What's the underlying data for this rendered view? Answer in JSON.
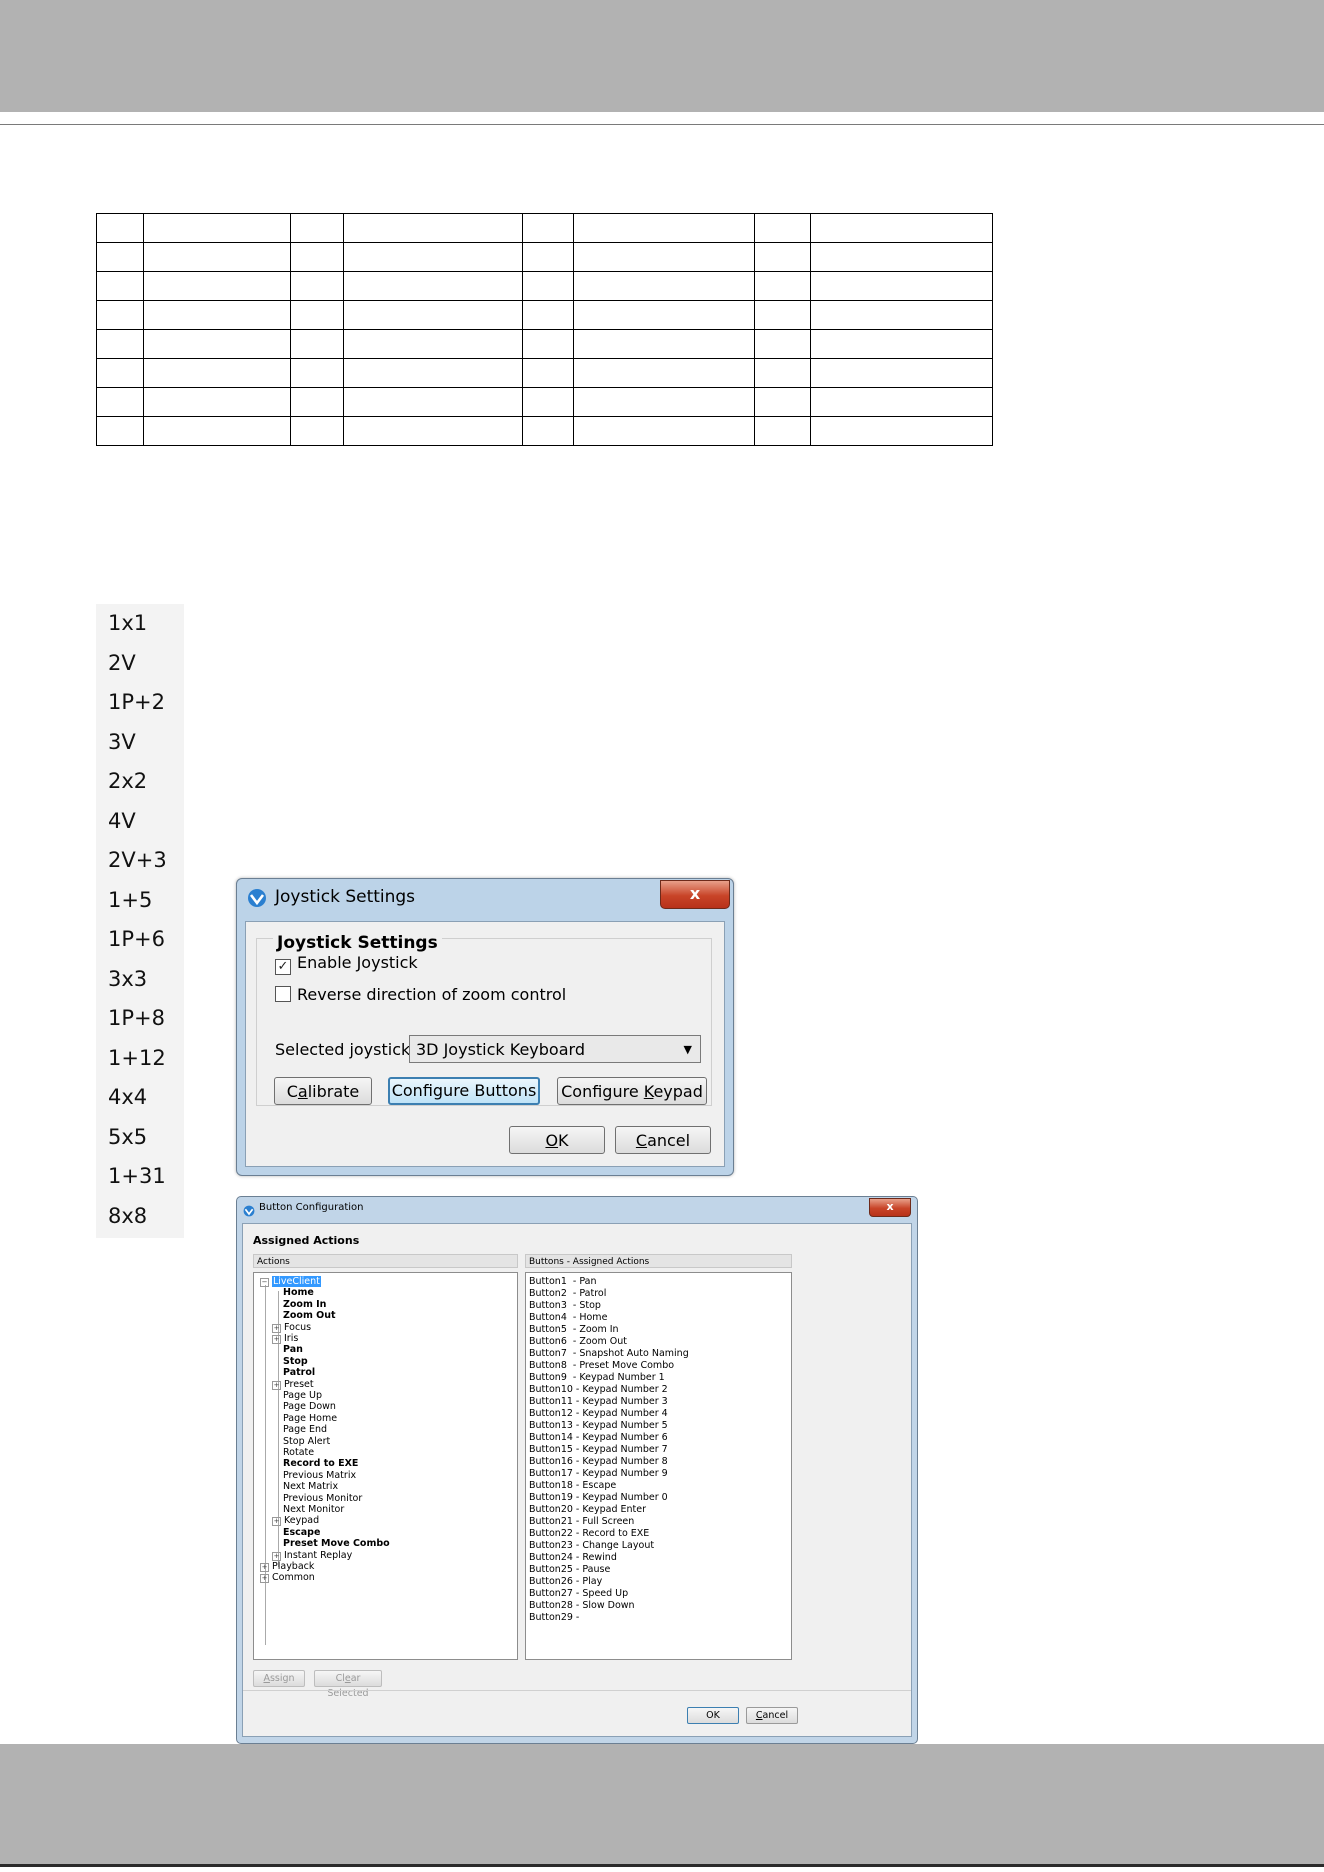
{
  "layouts": [
    "1x1",
    "2V",
    "1P+2",
    "3V",
    "2x2",
    "4V",
    "2V+3",
    "1+5",
    "1P+6",
    "3x3",
    "1P+8",
    "1+12",
    "4x4",
    "5x5",
    "1+31",
    "8x8"
  ],
  "joystick_settings": {
    "title": "Joystick Settings",
    "close_label": "x",
    "group_title": "Joystick Settings",
    "enable_joystick": {
      "label": "Enable Joystick",
      "checked": true
    },
    "reverse_zoom": {
      "label": "Reverse direction of zoom control",
      "checked": false
    },
    "selected_label": "Selected joystick:",
    "selected_value": "3D Joystick Keyboard",
    "calibrate": {
      "pre": "C",
      "u": "a",
      "post": "librate"
    },
    "configure_buttons": "Configure Buttons",
    "configure_keypad": {
      "pre": "Configure ",
      "u": "K",
      "post": "eypad"
    },
    "ok": {
      "pre": "",
      "u": "O",
      "post": "K"
    },
    "cancel": {
      "pre": "",
      "u": "C",
      "post": "ancel"
    }
  },
  "button_configuration": {
    "title": "Button Configuration",
    "close_label": "x",
    "heading": "Assigned Actions",
    "actions_header": "Actions",
    "buttons_header": "Buttons - Assigned Actions",
    "tree": [
      {
        "label": "LiveClient",
        "level": 0,
        "expander": "-",
        "bold": false,
        "selected": true
      },
      {
        "label": "Home",
        "level": 1,
        "bold": true
      },
      {
        "label": "Zoom In",
        "level": 1,
        "bold": true
      },
      {
        "label": "Zoom Out",
        "level": 1,
        "bold": true
      },
      {
        "label": "Focus",
        "level": 1,
        "expander": "+",
        "bold": false
      },
      {
        "label": "Iris",
        "level": 1,
        "expander": "+",
        "bold": false
      },
      {
        "label": "Pan",
        "level": 1,
        "bold": true
      },
      {
        "label": "Stop",
        "level": 1,
        "bold": true
      },
      {
        "label": "Patrol",
        "level": 1,
        "bold": true
      },
      {
        "label": "Preset",
        "level": 1,
        "expander": "+",
        "bold": false
      },
      {
        "label": "Page Up",
        "level": 1,
        "bold": false
      },
      {
        "label": "Page Down",
        "level": 1,
        "bold": false
      },
      {
        "label": "Page Home",
        "level": 1,
        "bold": false
      },
      {
        "label": "Page End",
        "level": 1,
        "bold": false
      },
      {
        "label": "Stop Alert",
        "level": 1,
        "bold": false
      },
      {
        "label": "Rotate",
        "level": 1,
        "bold": false
      },
      {
        "label": "Record to EXE",
        "level": 1,
        "bold": true
      },
      {
        "label": "Previous Matrix",
        "level": 1,
        "bold": false
      },
      {
        "label": "Next Matrix",
        "level": 1,
        "bold": false
      },
      {
        "label": "Previous Monitor",
        "level": 1,
        "bold": false
      },
      {
        "label": "Next Monitor",
        "level": 1,
        "bold": false
      },
      {
        "label": "Keypad",
        "level": 1,
        "expander": "+",
        "bold": false
      },
      {
        "label": "Escape",
        "level": 1,
        "bold": true
      },
      {
        "label": "Preset Move Combo",
        "level": 1,
        "bold": true
      },
      {
        "label": "Instant Replay",
        "level": 1,
        "expander": "+",
        "bold": false
      },
      {
        "label": "Playback",
        "level": 0,
        "expander": "+",
        "bold": false
      },
      {
        "label": "Common",
        "level": 0,
        "expander": "+",
        "bold": false
      }
    ],
    "buttons": [
      "Button1  - Pan",
      "Button2  - Patrol",
      "Button3  - Stop",
      "Button4  - Home",
      "Button5  - Zoom In",
      "Button6  - Zoom Out",
      "Button7  - Snapshot Auto Naming",
      "Button8  - Preset Move Combo",
      "Button9  - Keypad Number 1",
      "Button10 - Keypad Number 2",
      "Button11 - Keypad Number 3",
      "Button12 - Keypad Number 4",
      "Button13 - Keypad Number 5",
      "Button14 - Keypad Number 6",
      "Button15 - Keypad Number 7",
      "Button16 - Keypad Number 8",
      "Button17 - Keypad Number 9",
      "Button18 - Escape",
      "Button19 - Keypad Number 0",
      "Button20 - Keypad Enter",
      "Button21 - Full Screen",
      "Button22 - Record to EXE",
      "Button23 - Change Layout",
      "Button24 - Rewind",
      "Button25 - Pause",
      "Button26 - Play",
      "Button27 - Speed Up",
      "Button28 - Slow Down",
      "Button29 -"
    ],
    "assign": {
      "pre": "",
      "u": "A",
      "post": "ssign"
    },
    "clear_selected": {
      "pre": "Cl",
      "u": "e",
      "post": "ar Selected"
    },
    "ok": "OK",
    "cancel": {
      "pre": "",
      "u": "C",
      "post": "ancel"
    }
  }
}
